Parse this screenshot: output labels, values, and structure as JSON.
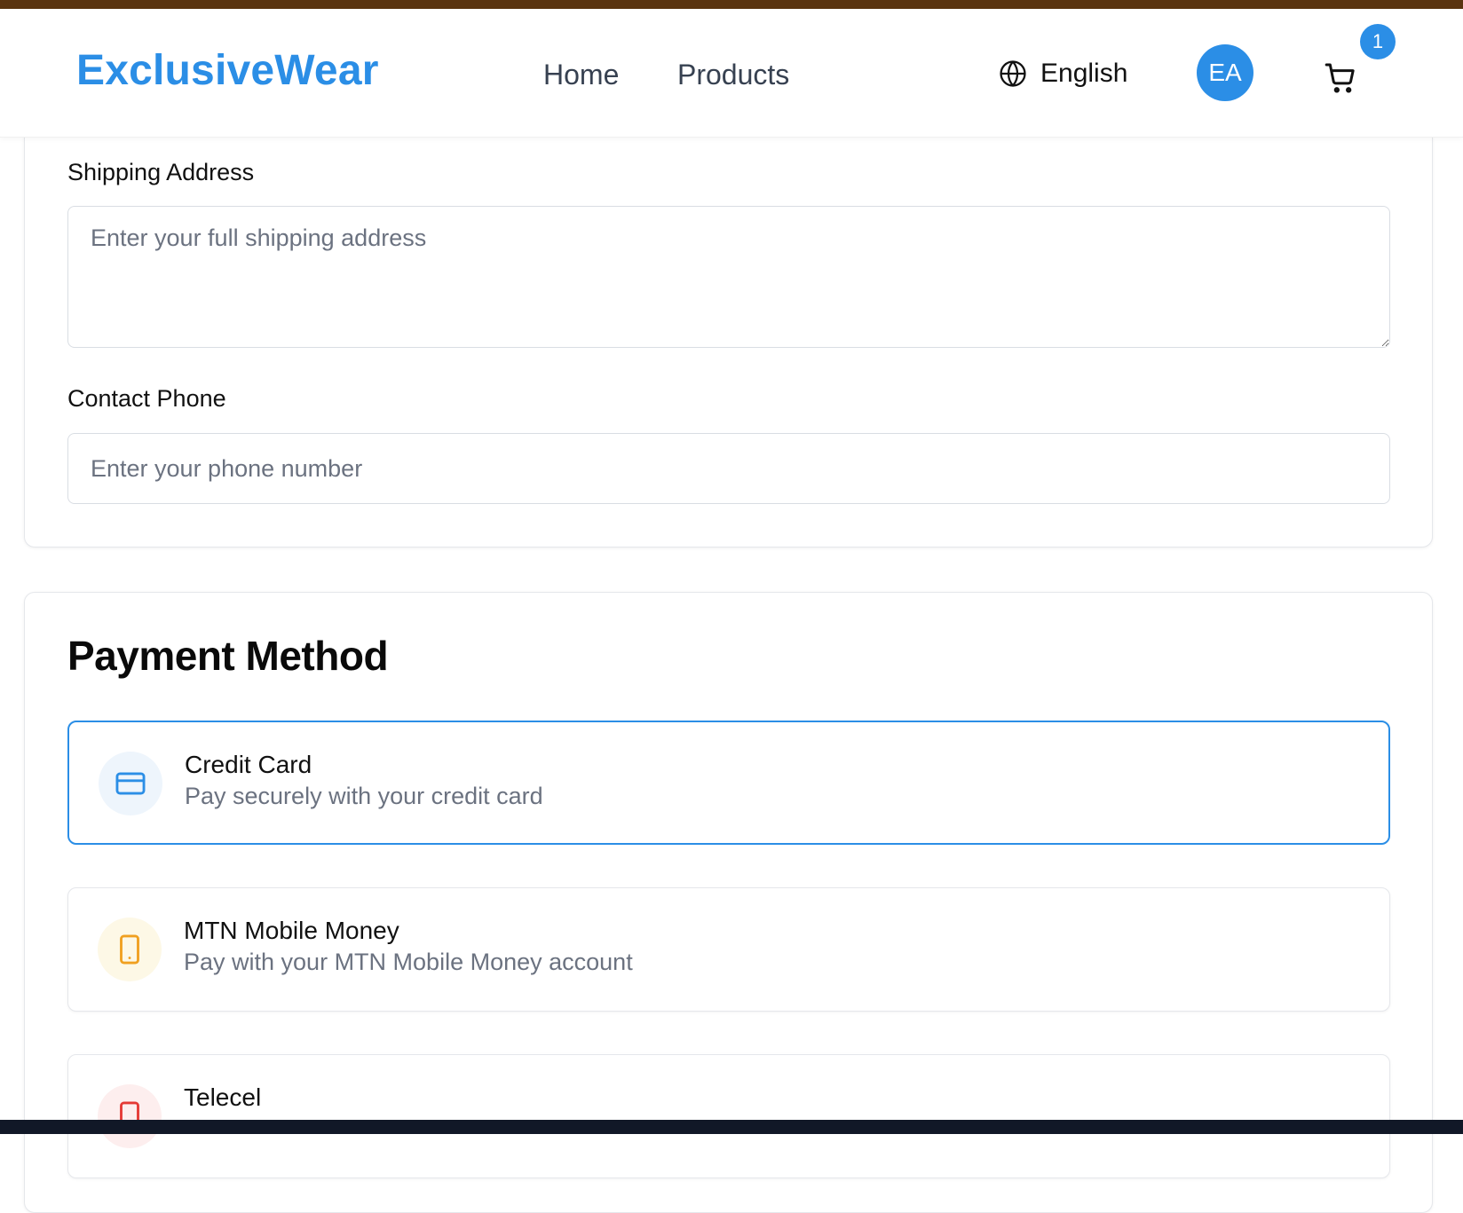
{
  "header": {
    "logo": "ExclusiveWear",
    "nav": {
      "home": "Home",
      "products": "Products"
    },
    "language": "English",
    "avatar_initials": "EA",
    "cart_count": "1"
  },
  "shipping": {
    "address_label": "Shipping Address",
    "address_placeholder": "Enter your full shipping address",
    "address_value": "",
    "phone_label": "Contact Phone",
    "phone_placeholder": "Enter your phone number",
    "phone_value": ""
  },
  "payment": {
    "title": "Payment Method",
    "selected": "credit-card",
    "options": [
      {
        "name": "Credit Card",
        "description": "Pay securely with your credit card",
        "icon": "credit-card-icon"
      },
      {
        "name": "MTN Mobile Money",
        "description": "Pay with your MTN Mobile Money account",
        "icon": "mobile-phone-icon"
      },
      {
        "name": "Telecel",
        "description": "",
        "icon": "mobile-phone-icon"
      }
    ]
  },
  "colors": {
    "brand": "#2b8ee6",
    "top_strip": "#5a3410",
    "bottom_strip": "#111827",
    "mtn_icon": "#f0a020",
    "telecel_icon": "#e53935"
  }
}
